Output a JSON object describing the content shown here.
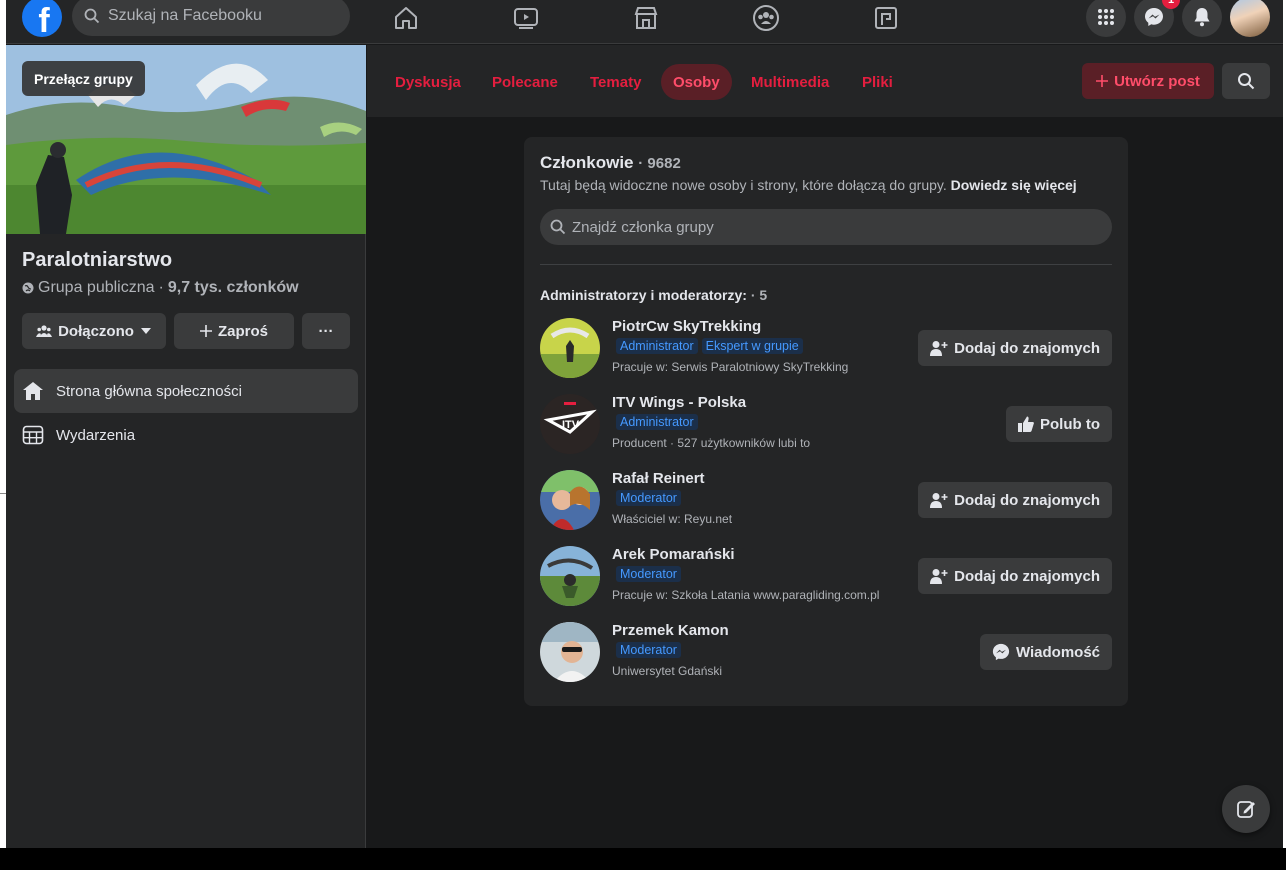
{
  "topbar": {
    "search_placeholder": "Szukaj na Facebooku",
    "messenger_badge": "1",
    "icons": [
      "home-icon",
      "watch-icon",
      "marketplace-icon",
      "groups-icon",
      "gaming-icon",
      "menu-grid-icon",
      "messenger-icon",
      "notifications-icon"
    ]
  },
  "sidebar": {
    "switch_label": "Przełącz grupy",
    "group_name": "Paralotniarstwo",
    "privacy": "Grupa publiczna",
    "members_summary": "9,7 tys. członków",
    "joined_label": "Dołączono",
    "invite_label": "Zaproś",
    "more_label": "···",
    "nav": [
      {
        "label": "Strona główna społeczności",
        "icon": "home-icon",
        "active": true
      },
      {
        "label": "Wydarzenia",
        "icon": "calendar-icon",
        "active": false
      }
    ]
  },
  "tabs": [
    {
      "label": "Dyskusja"
    },
    {
      "label": "Polecane"
    },
    {
      "label": "Tematy"
    },
    {
      "label": "Osoby",
      "active": true
    },
    {
      "label": "Multimedia"
    },
    {
      "label": "Pliki"
    }
  ],
  "create_post_label": "Utwórz post",
  "members": {
    "title": "Członkowie",
    "count": "· 9682",
    "subtitle": "Tutaj będą widoczne nowe osoby i strony, które dołączą do grupy.",
    "learn_more": "Dowiedz się więcej",
    "search_placeholder": "Znajdź członka grupy",
    "section_title": "Administratorzy i moderatorzy:",
    "section_count": "· 5",
    "list": [
      {
        "name": "PiotrCw SkyTrekking",
        "tags": [
          "Administrator",
          "Ekspert w grupie"
        ],
        "info": "Pracuje w: Serwis Paralotniowy SkyTrekking",
        "button": "Dodaj do znajomych",
        "button_icon": "add-friend-icon"
      },
      {
        "name": "ITV Wings - Polska",
        "tags": [
          "Administrator"
        ],
        "info": "Producent · 527 użytkowników lubi to",
        "button": "Polub to",
        "button_icon": "like-icon"
      },
      {
        "name": "Rafał Reinert",
        "tags": [
          "Moderator"
        ],
        "info": "Właściciel w: Reyu.net",
        "button": "Dodaj do znajomych",
        "button_icon": "add-friend-icon"
      },
      {
        "name": "Arek Pomarański",
        "tags": [
          "Moderator"
        ],
        "info": "Pracuje w: Szkoła Latania www.paragliding.com.pl",
        "button": "Dodaj do znajomych",
        "button_icon": "add-friend-icon"
      },
      {
        "name": "Przemek Kamon",
        "tags": [
          "Moderator"
        ],
        "info": "Uniwersytet Gdański",
        "button": "Wiadomość",
        "button_icon": "messenger-icon"
      }
    ]
  },
  "colors": {
    "accent": "#e41e3f",
    "tag_blue": "#4599ff",
    "facebook_blue": "#1877f2",
    "surface": "#242526",
    "background": "#18191a"
  }
}
